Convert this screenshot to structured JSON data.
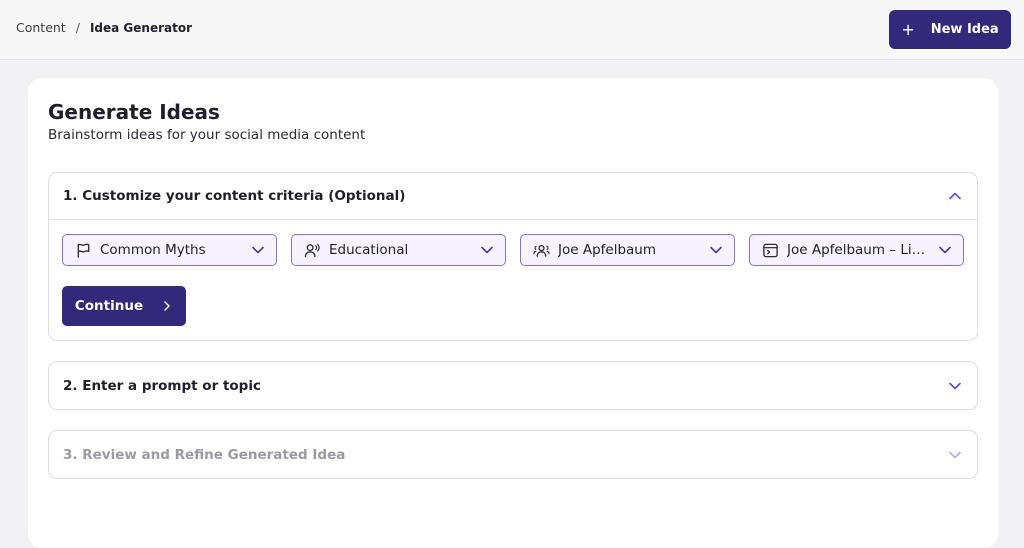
{
  "breadcrumb": {
    "parent": "Content",
    "separator": "/",
    "current": "Idea Generator"
  },
  "header": {
    "new_idea_label": "New Idea",
    "new_idea_icon": "plus-icon"
  },
  "page": {
    "title": "Generate Ideas",
    "subtitle": "Brainstorm ideas for your social media content"
  },
  "sections": [
    {
      "title": "1. Customize your content criteria (Optional)",
      "expanded": true,
      "enabled": true
    },
    {
      "title": "2. Enter a prompt or topic",
      "expanded": false,
      "enabled": true
    },
    {
      "title": "3. Review and Refine Generated Idea",
      "expanded": false,
      "enabled": false
    }
  ],
  "filters": [
    {
      "label": "Common Myths",
      "icon": "flag-icon"
    },
    {
      "label": "Educational",
      "icon": "speaker-user-icon"
    },
    {
      "label": "Joe Apfelbaum",
      "icon": "users-icon"
    },
    {
      "label": "Joe Apfelbaum – LinkedIn",
      "icon": "browser-window-icon"
    }
  ],
  "continue_label": "Continue",
  "colors": {
    "primary": "#33297a",
    "accent": "#6b47c8",
    "filter_bg": "#f6f3fc",
    "filter_border": "#8a6fd6",
    "disabled_text": "#9a9aa2"
  }
}
